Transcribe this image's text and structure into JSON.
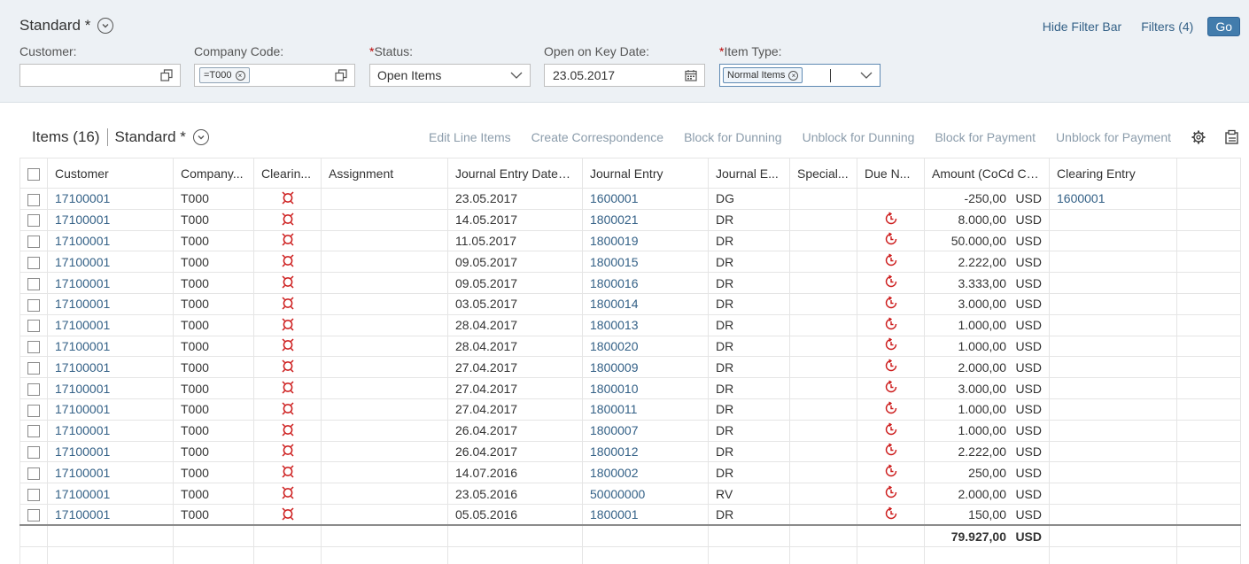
{
  "header": {
    "variant_title": "Standard *",
    "hide_filter_bar": "Hide Filter Bar",
    "filters": "Filters (4)",
    "go": "Go"
  },
  "filters": {
    "customer_label": "Customer:",
    "customer_value": "",
    "company_code_label": "Company Code:",
    "company_code_token": "=T000",
    "status_label": "Status:",
    "status_value": "Open Items",
    "key_date_label": "Open on Key Date:",
    "key_date_value": "23.05.2017",
    "item_type_label": "Item Type:",
    "item_type_token": "Normal Items"
  },
  "toolbar": {
    "title": "Items (16)",
    "variant": "Standard *",
    "actions": [
      "Edit Line Items",
      "Create Correspondence",
      "Block for Dunning",
      "Unblock for Dunning",
      "Block for Payment",
      "Unblock for Payment"
    ]
  },
  "columns": [
    "Customer",
    "Company...",
    "Clearin...",
    "Assignment",
    "Journal Entry Date",
    "Journal Entry",
    "Journal E...",
    "Special...",
    "Due N...",
    "Amount (CoCd Cur.)",
    "Clearing Entry"
  ],
  "rows": [
    {
      "customer": "17100001",
      "company": "T000",
      "date": "23.05.2017",
      "entry": "1600001",
      "type": "DG",
      "due": false,
      "amount": "-250,00",
      "currency": "USD",
      "clearing": "1600001"
    },
    {
      "customer": "17100001",
      "company": "T000",
      "date": "14.05.2017",
      "entry": "1800021",
      "type": "DR",
      "due": true,
      "amount": "8.000,00",
      "currency": "USD",
      "clearing": ""
    },
    {
      "customer": "17100001",
      "company": "T000",
      "date": "11.05.2017",
      "entry": "1800019",
      "type": "DR",
      "due": true,
      "amount": "50.000,00",
      "currency": "USD",
      "clearing": ""
    },
    {
      "customer": "17100001",
      "company": "T000",
      "date": "09.05.2017",
      "entry": "1800015",
      "type": "DR",
      "due": true,
      "amount": "2.222,00",
      "currency": "USD",
      "clearing": ""
    },
    {
      "customer": "17100001",
      "company": "T000",
      "date": "09.05.2017",
      "entry": "1800016",
      "type": "DR",
      "due": true,
      "amount": "3.333,00",
      "currency": "USD",
      "clearing": ""
    },
    {
      "customer": "17100001",
      "company": "T000",
      "date": "03.05.2017",
      "entry": "1800014",
      "type": "DR",
      "due": true,
      "amount": "3.000,00",
      "currency": "USD",
      "clearing": ""
    },
    {
      "customer": "17100001",
      "company": "T000",
      "date": "28.04.2017",
      "entry": "1800013",
      "type": "DR",
      "due": true,
      "amount": "1.000,00",
      "currency": "USD",
      "clearing": ""
    },
    {
      "customer": "17100001",
      "company": "T000",
      "date": "28.04.2017",
      "entry": "1800020",
      "type": "DR",
      "due": true,
      "amount": "1.000,00",
      "currency": "USD",
      "clearing": ""
    },
    {
      "customer": "17100001",
      "company": "T000",
      "date": "27.04.2017",
      "entry": "1800009",
      "type": "DR",
      "due": true,
      "amount": "2.000,00",
      "currency": "USD",
      "clearing": ""
    },
    {
      "customer": "17100001",
      "company": "T000",
      "date": "27.04.2017",
      "entry": "1800010",
      "type": "DR",
      "due": true,
      "amount": "3.000,00",
      "currency": "USD",
      "clearing": ""
    },
    {
      "customer": "17100001",
      "company": "T000",
      "date": "27.04.2017",
      "entry": "1800011",
      "type": "DR",
      "due": true,
      "amount": "1.000,00",
      "currency": "USD",
      "clearing": ""
    },
    {
      "customer": "17100001",
      "company": "T000",
      "date": "26.04.2017",
      "entry": "1800007",
      "type": "DR",
      "due": true,
      "amount": "1.000,00",
      "currency": "USD",
      "clearing": ""
    },
    {
      "customer": "17100001",
      "company": "T000",
      "date": "26.04.2017",
      "entry": "1800012",
      "type": "DR",
      "due": true,
      "amount": "2.222,00",
      "currency": "USD",
      "clearing": ""
    },
    {
      "customer": "17100001",
      "company": "T000",
      "date": "14.07.2016",
      "entry": "1800002",
      "type": "DR",
      "due": true,
      "amount": "250,00",
      "currency": "USD",
      "clearing": ""
    },
    {
      "customer": "17100001",
      "company": "T000",
      "date": "23.05.2016",
      "entry": "50000000",
      "type": "RV",
      "due": true,
      "amount": "2.000,00",
      "currency": "USD",
      "clearing": ""
    },
    {
      "customer": "17100001",
      "company": "T000",
      "date": "05.05.2016",
      "entry": "1800001",
      "type": "DR",
      "due": true,
      "amount": "150,00",
      "currency": "USD",
      "clearing": ""
    }
  ],
  "total": {
    "amount": "79.927,00",
    "currency": "USD"
  },
  "colors": {
    "link": "#346187",
    "accent": "#427cac",
    "status_red": "#cc1919",
    "disabled": "#8b9cab"
  }
}
